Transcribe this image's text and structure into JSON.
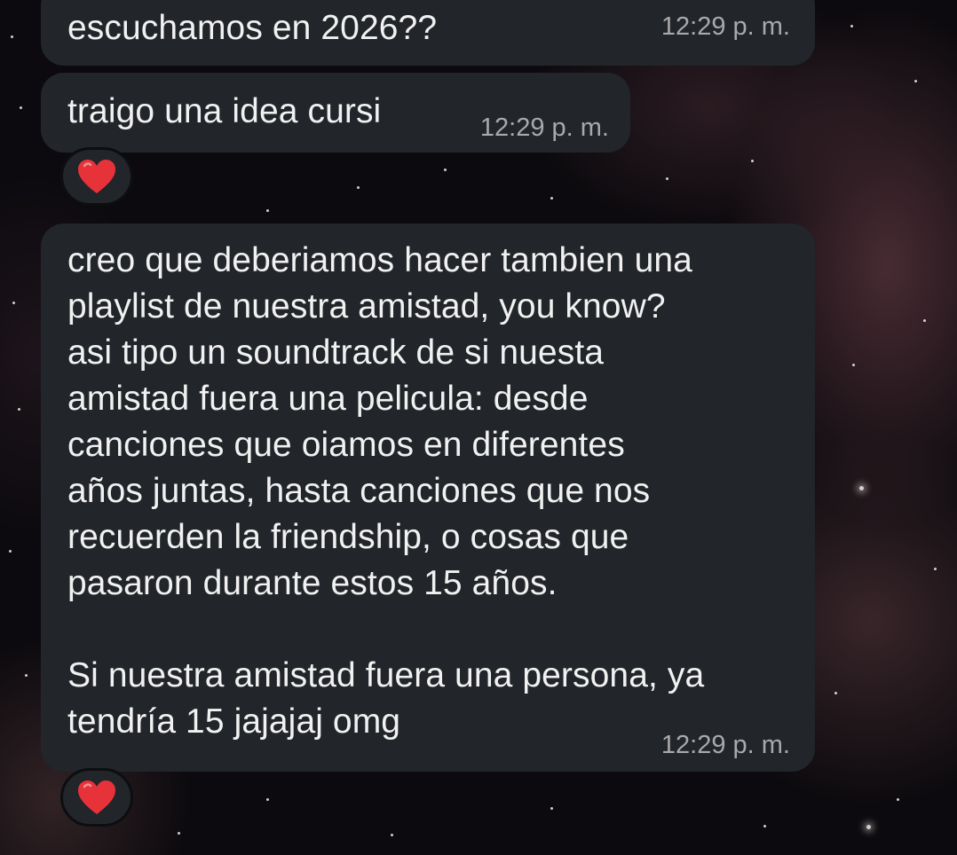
{
  "chat": {
    "messages": [
      {
        "text": "escuchamos en 2026??",
        "time": "12:29 p. m."
      },
      {
        "text": "traigo una idea cursi",
        "time": "12:29 p. m.",
        "reaction": "heart-icon"
      },
      {
        "text": "creo que deberiamos hacer tambien una\nplaylist de nuestra amistad, you know?\nasi tipo un soundtrack de si nuesta\namistad fuera una pelicula: desde\ncanciones que oiamos en diferentes\naños juntas, hasta canciones que nos\nrecuerden la friendship, o cosas que\npasaron durante estos 15 años.\n\nSi nuestra amistad fuera una persona, ya\ntendría 15 jajajaj omg",
        "time": "12:29 p. m.",
        "reaction": "heart-icon"
      }
    ]
  },
  "colors": {
    "bubble": "#222529",
    "text": "#f1f1f1",
    "timestamp": "#a9a9ab",
    "heart": "#e8323a"
  }
}
